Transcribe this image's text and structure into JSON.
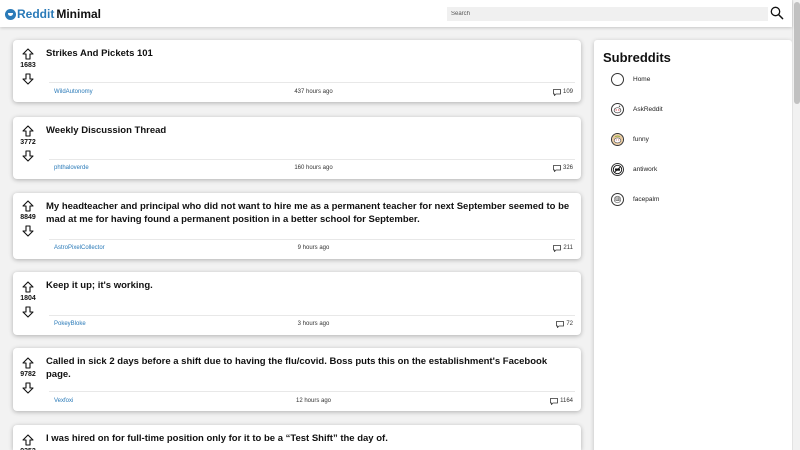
{
  "header": {
    "logo_accent": "Reddit",
    "logo_rest": "Minimal",
    "search_placeholder": "Search"
  },
  "posts": [
    {
      "votes": "1683",
      "title": "Strikes And Pickets 101",
      "author": "WildAutonomy",
      "time": "437 hours ago",
      "comments": "109"
    },
    {
      "votes": "3772",
      "title": "Weekly Discussion Thread",
      "author": "phthaloverde",
      "time": "160 hours ago",
      "comments": "326"
    },
    {
      "votes": "8849",
      "title": "My headteacher and principal who did not want to hire me as a permanent teacher for next September seemed to be mad at me for having found a permanent position in a better school for September.",
      "author": "AstroPixelCollector",
      "time": "9 hours ago",
      "comments": "211"
    },
    {
      "votes": "1804",
      "title": "Keep it up; it's working.",
      "author": "PokeyBloke",
      "time": "3 hours ago",
      "comments": "72"
    },
    {
      "votes": "9782",
      "title": "Called in sick 2 days before a shift due to having the flu/covid. Boss puts this on the establishment's Facebook page.",
      "author": "Vexfoxi",
      "time": "12 hours ago",
      "comments": "1164"
    },
    {
      "votes": "9352",
      "title": "I was hired on for full-time position only for it to be a “Test Shift” the day of.",
      "author": "",
      "time": "",
      "comments": ""
    }
  ],
  "sidebar": {
    "title": "Subreddits",
    "items": [
      {
        "label": "Home",
        "icon": "home-circle-icon"
      },
      {
        "label": "AskReddit",
        "icon": "askreddit-icon"
      },
      {
        "label": "funny",
        "icon": "funny-icon"
      },
      {
        "label": "antiwork",
        "icon": "antiwork-icon"
      },
      {
        "label": "facepalm",
        "icon": "facepalm-icon"
      }
    ]
  }
}
